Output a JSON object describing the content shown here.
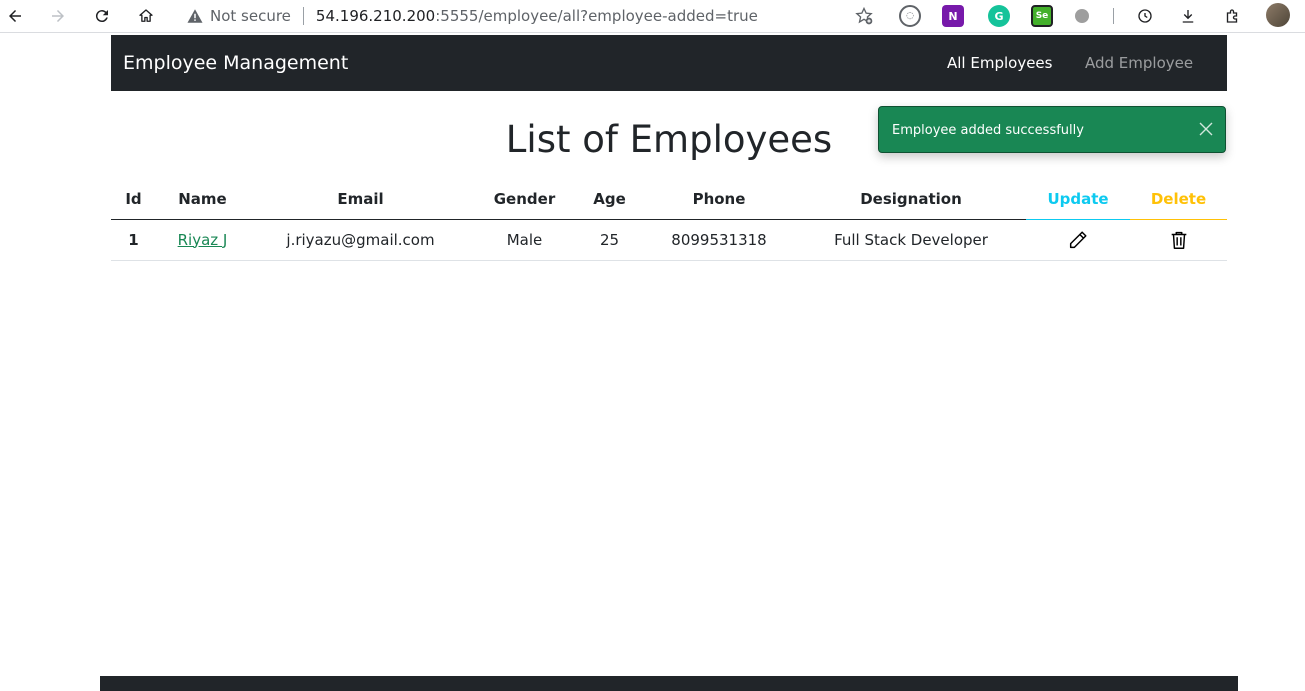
{
  "browser": {
    "security_label": "Not secure",
    "url_host": "54.196.210.200",
    "url_path": ":5555/employee/all?employee-added=true",
    "icons": [
      "back-icon",
      "forward-icon",
      "reload-icon",
      "home-icon",
      "warning-icon",
      "star-add-icon",
      "onenote-icon",
      "grammarly-icon",
      "selenium-icon",
      "history-icon",
      "download-icon",
      "extensions-icon",
      "avatar-icon"
    ]
  },
  "app": {
    "brand": "Employee Management",
    "nav": {
      "all_employees": "All Employees",
      "add_employee": "Add Employee"
    },
    "title": "List of Employees"
  },
  "toast": {
    "message": "Employee added successfully",
    "color": "#198754"
  },
  "table": {
    "headers": {
      "id": "Id",
      "name": "Name",
      "email": "Email",
      "gender": "Gender",
      "age": "Age",
      "phone": "Phone",
      "designation": "Designation",
      "update": "Update",
      "delete": "Delete"
    },
    "rows": [
      {
        "id": "1",
        "name": "Riyaz J",
        "email": "j.riyazu@gmail.com",
        "gender": "Male",
        "age": "25",
        "phone": "8099531318",
        "designation": "Full Stack Developer",
        "update_icon": "pencil-icon",
        "delete_icon": "trash-icon"
      }
    ]
  },
  "colors": {
    "navbar": "#212529",
    "update_accent": "#0dcaf0",
    "delete_accent": "#ffc107",
    "link": "#198754"
  }
}
